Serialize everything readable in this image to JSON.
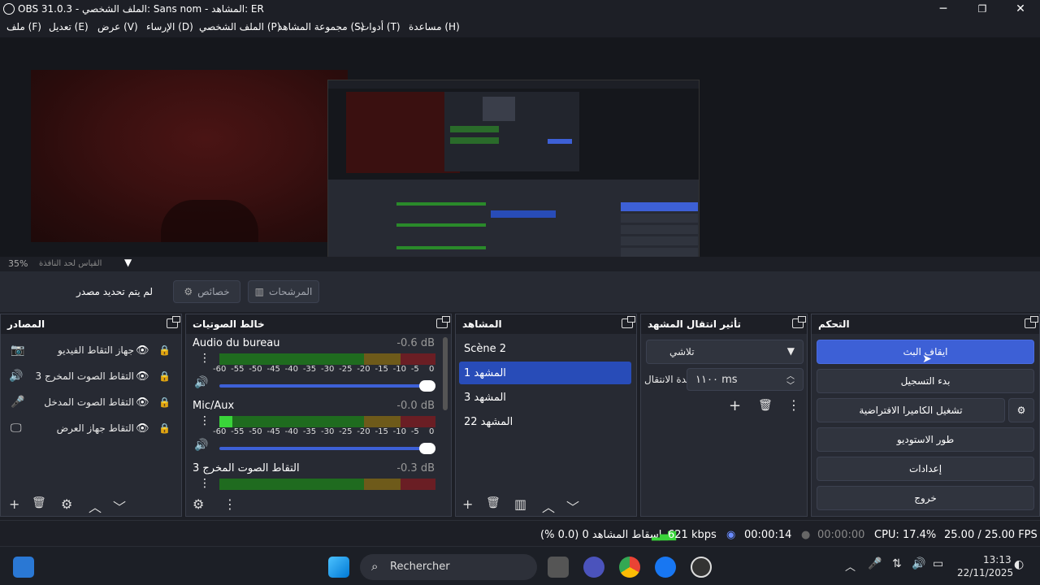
{
  "window": {
    "title": "OBS 31.0.3 - الملف الشخصي: Sans nom - المشاهد: ER",
    "minimize_glyph": "─",
    "maximize_glyph": "❐",
    "close_glyph": "✕"
  },
  "menu": {
    "items": [
      "ملف (F)",
      "تعديل (E)",
      "عرض (V)",
      "الإرساء (D)",
      "الملف الشخصي (P)",
      "مجموعة المشاهد (S)",
      "أدوات (T)",
      "مساعدة (H)"
    ]
  },
  "preview": {
    "zoom": "35%",
    "scale_mode": "القياس لحد النافذة"
  },
  "source_bar": {
    "no_source": "لم يتم تحديد مصدر",
    "properties": "خصائص",
    "filters": "المرشحات"
  },
  "sources": {
    "title": "المصادر",
    "items": [
      {
        "label": "جهاز التقاط الفيديو",
        "icon": "camera-icon"
      },
      {
        "label": "التقاط الصوت المخرج 3",
        "icon": "speaker-icon"
      },
      {
        "label": "التقاط الصوت المدخل",
        "icon": "microphone-icon"
      },
      {
        "label": "التقاط جهاز العرض",
        "icon": "monitor-icon"
      }
    ]
  },
  "mixer": {
    "title": "خالط الصوتيات",
    "scale": [
      "-60",
      "-55",
      "-50",
      "-45",
      "-40",
      "-35",
      "-30",
      "-25",
      "-20",
      "-15",
      "-10",
      "-5",
      "0"
    ],
    "channels": [
      {
        "name": "Audio du bureau",
        "db": "-0.6 dB",
        "level": 0.0,
        "volume": 1.0
      },
      {
        "name": "Mic/Aux",
        "db": "-0.0 dB",
        "level": 0.06,
        "volume": 1.0
      },
      {
        "name": "التقاط الصوت المخرج 3",
        "db": "-0.3 dB",
        "level": 0.0,
        "volume": 1.0
      }
    ]
  },
  "scenes": {
    "title": "المشاهد",
    "items": [
      "Scène 2",
      "المشهد 1",
      "المشهد 3",
      "المشهد 22"
    ],
    "active_index": 1
  },
  "transitions": {
    "title": "تأثير انتقال المشهد",
    "type": "تلاشي",
    "duration_label": "مدة الانتقال",
    "duration_value": "١١٠٠ ms"
  },
  "controls": {
    "title": "التحكم",
    "stop_stream": "ايقاف البث",
    "start_recording": "بدء التسجيل",
    "virtual_camera": "تشغيل الكاميرا الافتراضية",
    "studio_mode": "طور الاستوديو",
    "settings": "إعدادات",
    "exit": "خروج"
  },
  "status": {
    "dropped": "إسقاط المشاهد 0 (0.0 %)",
    "bitrate": "621 kbps",
    "stream_time": "00:00:14",
    "record_time": "00:00:00",
    "cpu": "CPU: 17.4%",
    "fps": "25.00 / 25.00 FPS"
  },
  "taskbar": {
    "search_placeholder": "Rechercher",
    "time": "13:13",
    "date": "22/11/2025"
  },
  "colors": {
    "accent": "#3d60d6",
    "active_scene": "#284cb8",
    "panel": "#272a33",
    "dark": "#1d1f26"
  }
}
